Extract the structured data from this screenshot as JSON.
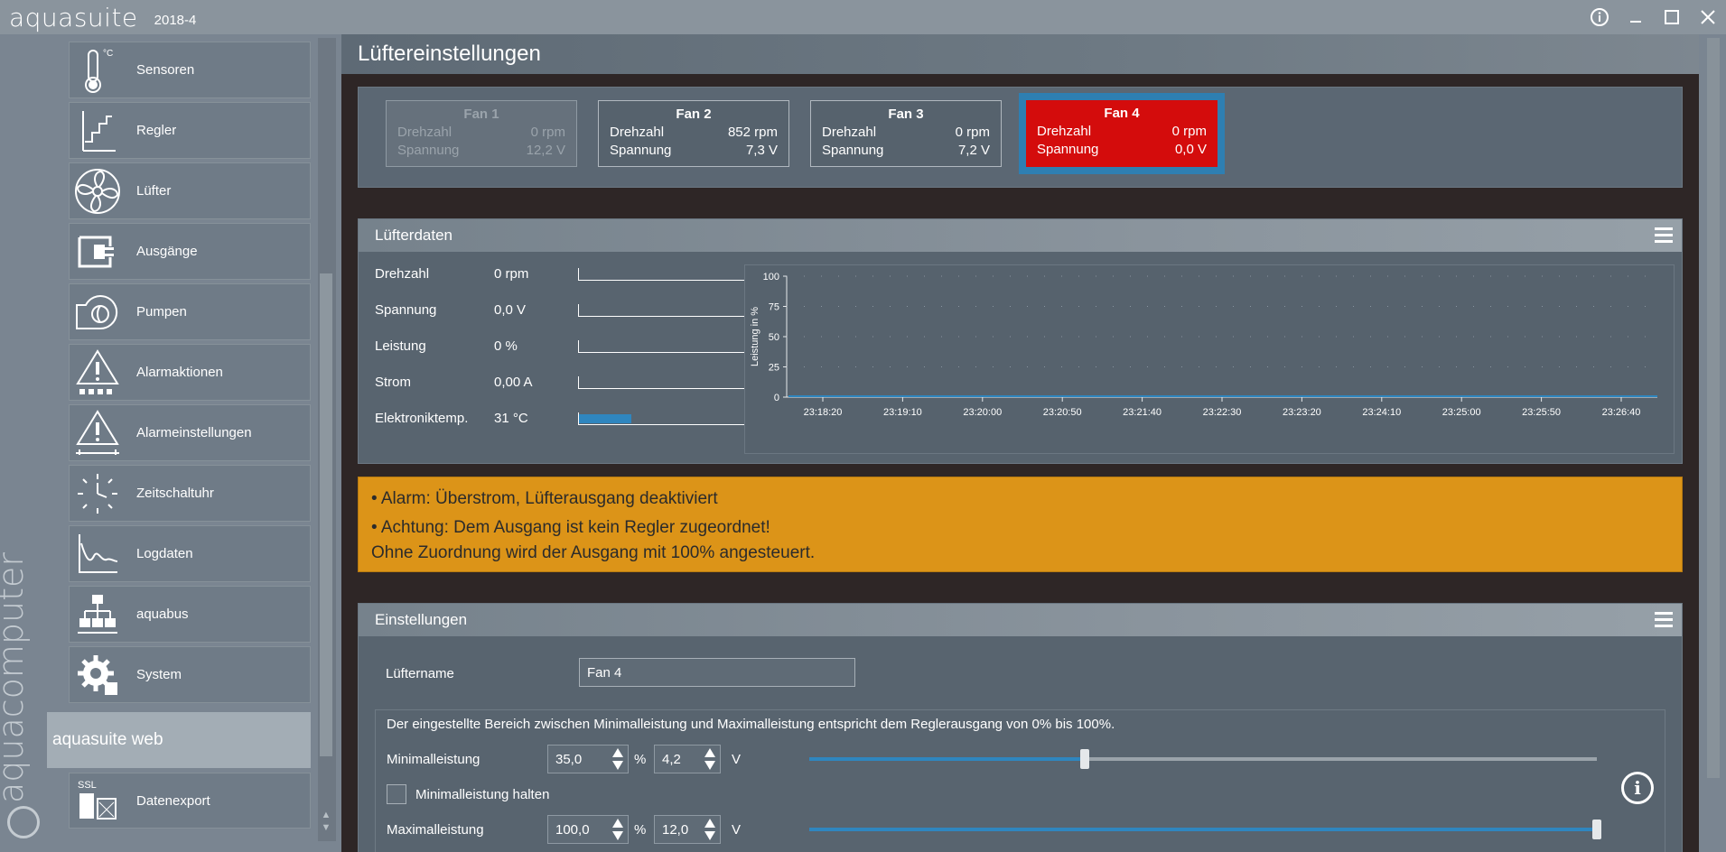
{
  "app": {
    "name": "aquasuite",
    "version": "2018-4"
  },
  "window_controls": {
    "info": "ⓘ",
    "minimize": "–",
    "maximize": "☐",
    "close": "✕"
  },
  "sidebar": {
    "brand": "aquacomputer",
    "items": [
      {
        "label": "Sensoren",
        "icon": "thermometer-icon"
      },
      {
        "label": "Regler",
        "icon": "regler-icon"
      },
      {
        "label": "Lüfter",
        "icon": "fan-icon"
      },
      {
        "label": "Ausgänge",
        "icon": "plug-icon"
      },
      {
        "label": "Pumpen",
        "icon": "pump-icon"
      },
      {
        "label": "Alarmaktionen",
        "icon": "alarm-icon"
      },
      {
        "label": "Alarmeinstellungen",
        "icon": "alarm-settings-icon"
      },
      {
        "label": "Zeitschaltuhr",
        "icon": "clock-icon"
      },
      {
        "label": "Logdaten",
        "icon": "chart-icon"
      },
      {
        "label": "aquabus",
        "icon": "network-icon"
      },
      {
        "label": "System",
        "icon": "gear-icon"
      }
    ],
    "web_header": "aquasuite web",
    "export_label": "Datenexport",
    "export_icon_text": "SSL"
  },
  "page": {
    "title": "Lüftereinstellungen"
  },
  "fans": [
    {
      "name": "Fan 1",
      "speed_label": "Drehzahl",
      "speed": "0 rpm",
      "voltage_label": "Spannung",
      "voltage": "12,2 V"
    },
    {
      "name": "Fan 2",
      "speed_label": "Drehzahl",
      "speed": "852 rpm",
      "voltage_label": "Spannung",
      "voltage": "7,3 V"
    },
    {
      "name": "Fan 3",
      "speed_label": "Drehzahl",
      "speed": "0 rpm",
      "voltage_label": "Spannung",
      "voltage": "7,2 V"
    },
    {
      "name": "Fan 4",
      "speed_label": "Drehzahl",
      "speed": "0 rpm",
      "voltage_label": "Spannung",
      "voltage": "0,0 V"
    }
  ],
  "fan_data": {
    "title": "Lüfterdaten",
    "rows": [
      {
        "label": "Drehzahl",
        "value": "0 rpm",
        "level": 0
      },
      {
        "label": "Spannung",
        "value": "0,0 V",
        "level": 0
      },
      {
        "label": "Leistung",
        "value": "0 %",
        "level": 0
      },
      {
        "label": "Strom",
        "value": "0,00 A",
        "level": 0
      },
      {
        "label": "Elektroniktemp.",
        "value": "31 °C",
        "level": 0.31
      }
    ]
  },
  "chart_data": {
    "type": "line",
    "ylabel": "Leistung in %",
    "ylim": [
      0,
      100
    ],
    "yticks": [
      "100",
      "75",
      "50",
      "25",
      "0"
    ],
    "x": [
      "23:18:20",
      "23:19:10",
      "23:20:00",
      "23:20:50",
      "23:21:40",
      "23:22:30",
      "23:23:20",
      "23:24:10",
      "23:25:00",
      "23:25:50",
      "23:26:40"
    ],
    "series": [
      {
        "values": [
          0,
          0,
          0,
          0,
          0,
          0,
          0,
          0,
          0,
          0,
          0
        ]
      }
    ],
    "grid": true,
    "color": "#2f86bf"
  },
  "alerts": {
    "line1": "• Alarm: Überstrom, Lüfterausgang deaktiviert",
    "line2": "• Achtung: Dem Ausgang ist kein Regler zugeordnet!",
    "line3": "Ohne Zuordnung wird der Ausgang mit 100% angesteuert."
  },
  "settings": {
    "title": "Einstellungen",
    "name_label": "Lüftername",
    "name_value": "Fan 4",
    "range_note": "Der eingestellte Bereich zwischen Minimalleistung und Maximalleistung entspricht dem Reglerausgang von 0% bis 100%.",
    "min_label": "Minimalleistung",
    "min_percent": "35,0",
    "min_volt": "4,2",
    "min_level": 0.35,
    "hold_min_label": "Minimalleistung halten",
    "hold_min_checked": false,
    "max_label": "Maximalleistung",
    "max_percent": "100,0",
    "max_volt": "12,0",
    "max_level": 1.0,
    "percent_unit": "%",
    "volt_unit": "V"
  },
  "colors": {
    "accent": "#2f86bf",
    "alert": "#dc9418",
    "selected_fan": "#d40c0c"
  }
}
